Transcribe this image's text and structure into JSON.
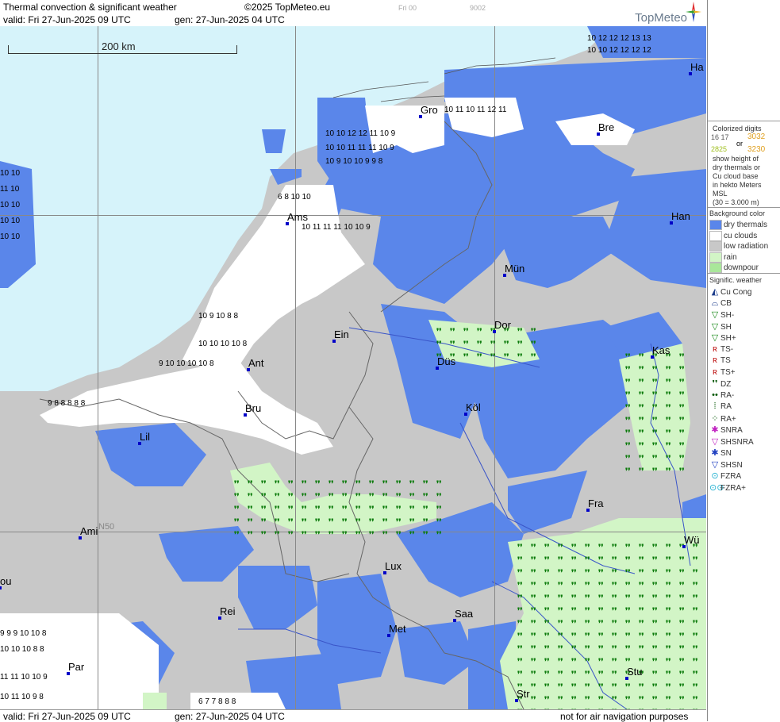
{
  "header": {
    "title": "Thermal convection & significant weather",
    "copyright": "©2025 TopMeteo.eu",
    "valid": "valid:  Fri  27-Jun-2025  09 UTC",
    "gen": "gen: 27-Jun-2025 04 UTC",
    "faint_day": "Fri 00",
    "faint_code": "9002",
    "logo_text": "TopMeteo"
  },
  "footer": {
    "valid": "valid:  Fri  27-Jun-2025  09 UTC",
    "gen": "gen: 27-Jun-2025 04 UTC",
    "disclaimer": "not for air navigation purposes"
  },
  "map": {
    "scale_label": "200 km",
    "lat_label": "N50",
    "cities": [
      {
        "name": "Gro"
      },
      {
        "name": "Bre"
      },
      {
        "name": "Ams"
      },
      {
        "name": "Han"
      },
      {
        "name": "Mün"
      },
      {
        "name": "Ein"
      },
      {
        "name": "Dor"
      },
      {
        "name": "Kas"
      },
      {
        "name": "Ant"
      },
      {
        "name": "Düs"
      },
      {
        "name": "Bru"
      },
      {
        "name": "Köl"
      },
      {
        "name": "Lil"
      },
      {
        "name": "Fra"
      },
      {
        "name": "Ami"
      },
      {
        "name": "Wü"
      },
      {
        "name": "Lux"
      },
      {
        "name": "Rei"
      },
      {
        "name": "Saa"
      },
      {
        "name": "Met"
      },
      {
        "name": "Par"
      },
      {
        "name": "Stu"
      },
      {
        "name": "Str"
      },
      {
        "name": "Ha"
      },
      {
        "name": "ou"
      }
    ]
  },
  "legend": {
    "colorized_title": "Colorized digits",
    "example_a": "16  17",
    "or": "or",
    "example_b": "3032",
    "example_c": "2825",
    "example_d": "3230",
    "explain": [
      "show height of",
      "dry thermals or",
      "Cu cloud base",
      "in hekto Meters",
      "MSL",
      "(30 = 3.000 m)"
    ],
    "bg_title": "Background color",
    "bg_items": [
      {
        "label": "dry thermals",
        "color": "#5a86ea"
      },
      {
        "label": "cu clouds",
        "color": "#ffffff"
      },
      {
        "label": "low radiation",
        "color": "#c8c8c8"
      },
      {
        "label": "rain",
        "color": "#d2f5c6"
      },
      {
        "label": "downpour",
        "color": "#a9e79a"
      }
    ],
    "wx_title": "Signific. weather",
    "wx_items": [
      {
        "label": "Cu Cong",
        "icon": "cu-cong-icon",
        "glyph": "◭",
        "color": "#1a3b8a"
      },
      {
        "label": "CB",
        "icon": "cb-icon",
        "glyph": "⌓",
        "color": "#1a3b8a"
      },
      {
        "label": "SH-",
        "icon": "shower-light-icon",
        "glyph": "▽",
        "color": "#1a8a1a"
      },
      {
        "label": "SH",
        "icon": "shower-icon",
        "glyph": "▽",
        "color": "#1a8a1a"
      },
      {
        "label": "SH+",
        "icon": "shower-heavy-icon",
        "glyph": "▽",
        "color": "#1a8a1a"
      },
      {
        "label": "TS-",
        "icon": "thunderstorm-light-icon",
        "glyph": "ʀ",
        "color": "#c01818"
      },
      {
        "label": "TS",
        "icon": "thunderstorm-icon",
        "glyph": "ʀ",
        "color": "#c01818"
      },
      {
        "label": "TS+",
        "icon": "thunderstorm-heavy-icon",
        "glyph": "ʀ",
        "color": "#c01818"
      },
      {
        "label": "DZ",
        "icon": "drizzle-icon",
        "glyph": "❜❜",
        "color": "#0a5a0a"
      },
      {
        "label": "RA-",
        "icon": "rain-light-icon",
        "glyph": "••",
        "color": "#0a5a0a"
      },
      {
        "label": "RA",
        "icon": "rain-icon",
        "glyph": "⁞",
        "color": "#0a5a0a"
      },
      {
        "label": "RA+",
        "icon": "rain-heavy-icon",
        "glyph": "⁘",
        "color": "#0a5a0a"
      },
      {
        "label": "SNRA",
        "icon": "snow-rain-icon",
        "glyph": "✱",
        "color": "#c020c0"
      },
      {
        "label": "SHSNRA",
        "icon": "snow-rain-shower-icon",
        "glyph": "▽",
        "color": "#c020c0"
      },
      {
        "label": "SN",
        "icon": "snow-icon",
        "glyph": "✱",
        "color": "#2040c0"
      },
      {
        "label": "SHSN",
        "icon": "snow-shower-icon",
        "glyph": "▽",
        "color": "#2040c0"
      },
      {
        "label": "FZRA",
        "icon": "freezing-rain-icon",
        "glyph": "⊙",
        "color": "#20b0d0"
      },
      {
        "label": "FZRA+",
        "icon": "freezing-rain-heavy-icon",
        "glyph": "⊙⊙",
        "color": "#20b0d0"
      }
    ]
  }
}
